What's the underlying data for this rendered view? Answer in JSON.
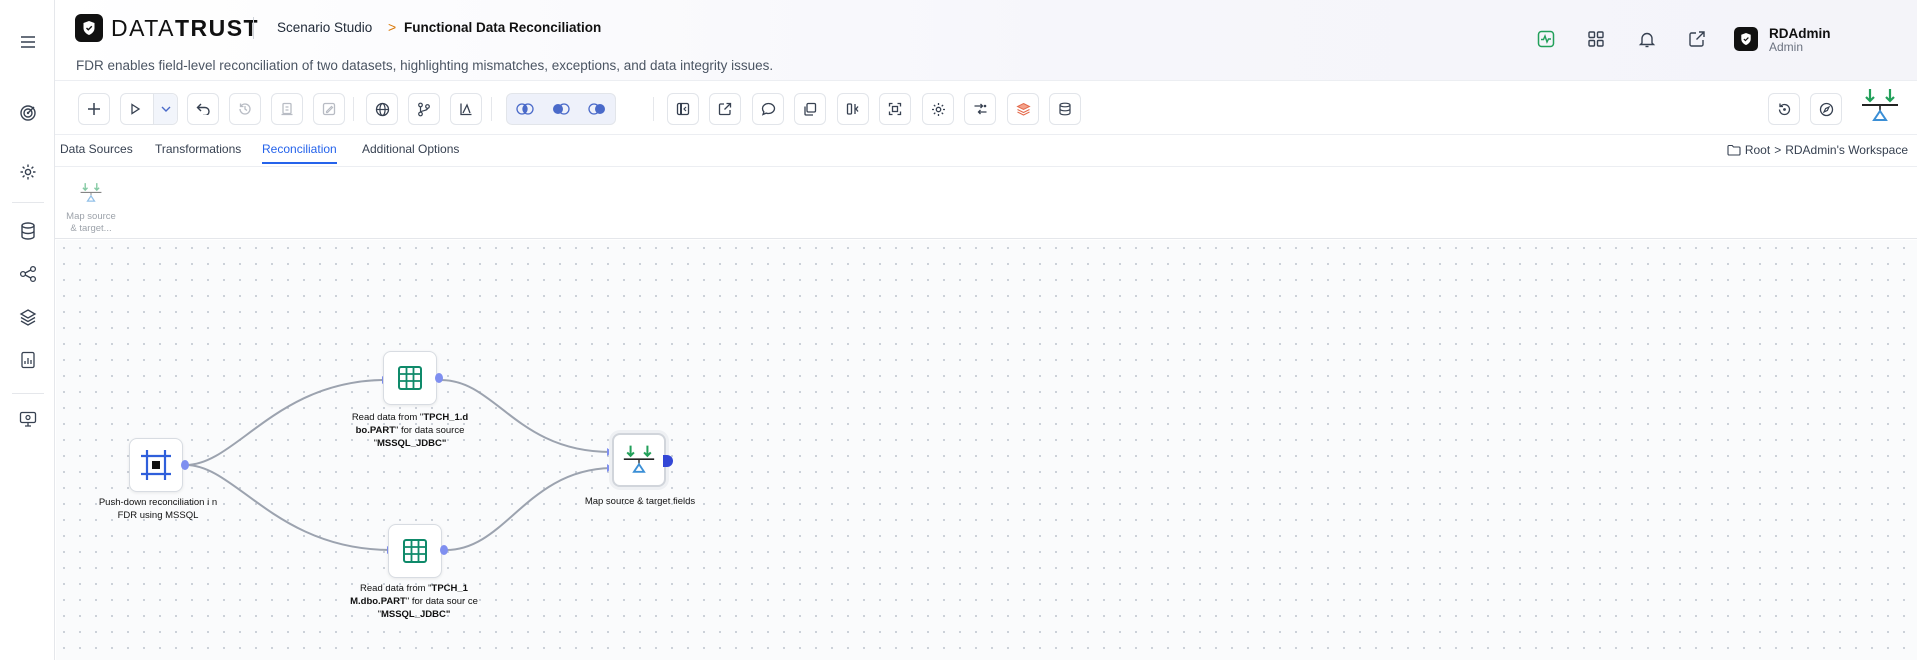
{
  "rail": {
    "items": [
      "menu-icon",
      "target-icon",
      "gear-icon",
      "database-icon",
      "network-icon",
      "layers-icon",
      "report-icon",
      "monitor-settings-icon"
    ]
  },
  "header": {
    "logo_light": "DATA",
    "logo_bold": "TRUST",
    "breadcrumb_parent": "Scenario Studio",
    "breadcrumb_sep": ">",
    "breadcrumb_current": "Functional Data Reconciliation",
    "subtitle": "FDR enables field-level reconciliation of two datasets, highlighting mismatches, exceptions, and data integrity issues.",
    "icons": [
      "activity-icon",
      "apps-grid-icon",
      "bell-icon",
      "external-link-icon",
      "help-icon"
    ],
    "user": {
      "name": "RDAdmin",
      "role": "Admin"
    },
    "accent": "#22a05a"
  },
  "toolbar": {
    "buttons": [
      "add-icon",
      "run-icon",
      "undo-icon",
      "history-icon",
      "clear-icon",
      "edit-icon",
      "globe-icon",
      "branch-icon",
      "chart-icon",
      "intersect-icon",
      "left-join-icon",
      "right-join-icon",
      "collapse-icon",
      "export-icon",
      "comment-icon",
      "copy-icon",
      "compare-icon",
      "scan-icon",
      "settings-icon",
      "transform-icon",
      "stack-icon",
      "database-icon",
      "restore-icon",
      "compass-icon",
      "reconcile-icon"
    ]
  },
  "tabs": {
    "items": [
      "Data Sources",
      "Transformations",
      "Reconciliation",
      "Additional Options"
    ],
    "active": "Reconciliation",
    "path_root": "Root",
    "path_sep": ">",
    "path_workspace": "RDAdmin's Workspace"
  },
  "palette": {
    "item_label": "Map source & target..."
  },
  "canvas": {
    "nodes": {
      "pushdown": {
        "label": "Push-down reconciliation i n FDR using MSSQL"
      },
      "read1": {
        "prefix": "Read data from \"",
        "bold1": "TPCH_1.d bo.PART",
        "mid": "\" for data source \"",
        "bold2": "MSSQL_JDBC",
        "suffix": "\""
      },
      "read2": {
        "prefix": "Read data from \"",
        "bold1": "TPCH_1 M.dbo.PART",
        "mid": "\" for data sour ce \"",
        "bold2": "MSSQL_JDBC",
        "suffix": "\""
      },
      "map": {
        "label": "Map source & target fields"
      }
    }
  }
}
